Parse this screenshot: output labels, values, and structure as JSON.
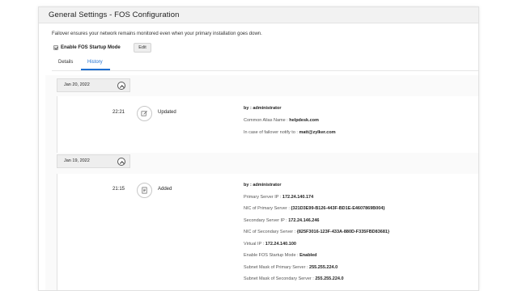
{
  "panel": {
    "title": "General Settings - FOS Configuration",
    "description": "Failover ensures your network remains monitored even when your primary installation goes down.",
    "enable_label": "Enable FOS Startup Mode",
    "edit_label": "Edit"
  },
  "tabs": [
    {
      "label": "Details"
    },
    {
      "label": "History"
    }
  ],
  "history": [
    {
      "date": "Jan 20, 2022",
      "time": "22:21",
      "action": "Updated",
      "icon": "edit-icon",
      "details": [
        {
          "label": "by :",
          "value": "administrator"
        },
        {
          "label": "Common Alias Name :",
          "value": "helpdesk.com"
        },
        {
          "label": "In case of failover notify to :",
          "value": "matt@zylker.com"
        }
      ]
    },
    {
      "date": "Jan 19, 2022",
      "time": "21:15",
      "action": "Added",
      "icon": "document-icon",
      "details": [
        {
          "label": "by :",
          "value": "administrator"
        },
        {
          "label": "Primary Server IP :",
          "value": "172.24.140.174"
        },
        {
          "label": "NIC of Primary Server :",
          "value": "{321D3E99-B126-443F-BD1E-E4607869B004}"
        },
        {
          "label": "Secondary Server IP :",
          "value": "172.24.146.246"
        },
        {
          "label": "NIC of Secondary Server :",
          "value": "{825F3016-123F-433A-880D-F335FBD83681}"
        },
        {
          "label": "Virtual IP :",
          "value": "172.24.140.100"
        },
        {
          "label": "Enable FOS Startup Mode :",
          "value": "Enabled"
        },
        {
          "label": "Subnet Mask of Primary Server :",
          "value": "255.255.224.0"
        },
        {
          "label": "Subnet Mask of Secondary Server :",
          "value": "255.255.224.0"
        }
      ]
    }
  ],
  "colors": {
    "accent": "#1e6fd1",
    "header_bg": "#f2f2f2",
    "date_bar_bg": "#eeeeee"
  }
}
